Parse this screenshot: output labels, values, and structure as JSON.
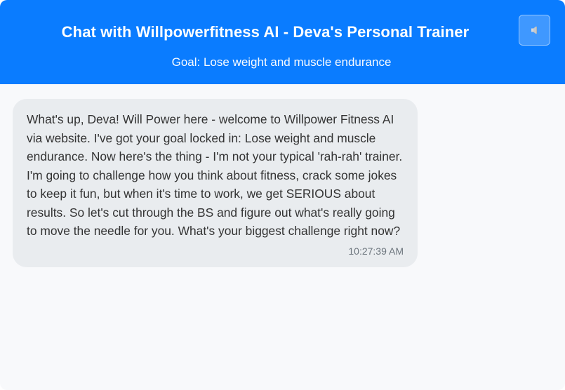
{
  "header": {
    "title": "Chat with Willpowerfitness AI - Deva's Personal Trainer",
    "goal": "Goal: Lose weight and muscle endurance",
    "background_color": "#0a7cff",
    "sound_button": {
      "icon": "speaker-icon"
    }
  },
  "messages": [
    {
      "sender": "assistant",
      "text": "What's up, Deva! Will Power here - welcome to Willpower Fitness AI via website. I've got your goal locked in: Lose weight and muscle endurance. Now here's the thing - I'm not your typical 'rah-rah' trainer. I'm going to challenge how you think about fitness, crack some jokes to keep it fun, but when it's time to work, we get SERIOUS about results. So let's cut through the BS and figure out what's really going to move the needle for you. What's your biggest challenge right now?",
      "time": "10:27:39 AM",
      "bubble_color": "#e9ecef"
    }
  ]
}
